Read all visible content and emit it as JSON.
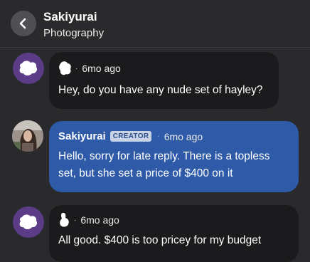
{
  "header": {
    "back_icon": "chevron-left-icon",
    "title": "Sakiyurai",
    "subtitle": "Photography"
  },
  "messages": [
    {
      "time": "6mo ago",
      "text": "Hey, do you have any nude set of hayley?",
      "avatar_icon": "anonymous-blob-icon"
    },
    {
      "sender": "Sakiyurai",
      "badge": "CREATOR",
      "time": "6mo ago",
      "text": "Hello, sorry for late reply. There is a topless set, but she set a price of $400 on it",
      "avatar_icon": "creator-photo-avatar"
    },
    {
      "time": "6mo ago",
      "text": "All good. $400 is too pricey for my budget",
      "avatar_icon": "anonymous-blob-icon"
    }
  ],
  "colors": {
    "background": "#2a2a2c",
    "dark_bubble": "#1b1b1d",
    "creator_bubble": "#2e5aa8",
    "avatar_purple": "#5c3c86"
  }
}
